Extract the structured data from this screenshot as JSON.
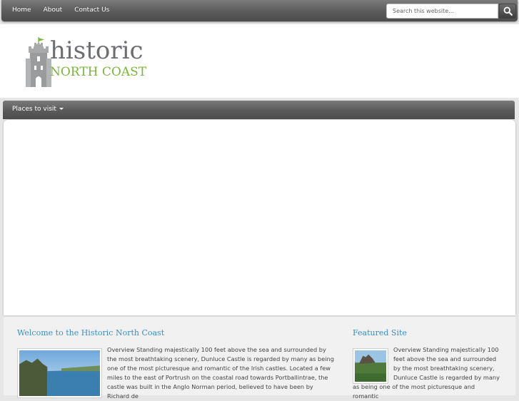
{
  "topnav": {
    "items": [
      "Home",
      "About",
      "Contact Us"
    ]
  },
  "search": {
    "placeholder": "Search this website…"
  },
  "logo": {
    "line1": "historic",
    "line2": "NORTH COAST"
  },
  "menu": {
    "places_label": "Places to visit"
  },
  "welcome": {
    "title": "Welcome to the Historic North Coast",
    "text": "Overview Standing majestically 100 feet above the sea and surrounded by the most breathtaking scenery, Dunluce Castle is regarded by many as being one of the most picturesque and romantic of the Irish castles. Located a few miles to the east of Portrush on the coastal road towards Portballintrae, the castle was built in the Anglo Norman period, believed to have been by Richard de"
  },
  "featured": {
    "title": "Featured Site",
    "text_indented": "Overview Standing majestically 100 feet above the sea and surrounded by the most breathtaking scenery, Dunluce Castle is regarded by many",
    "text_full": "as being one of the most picturesque and romantic"
  },
  "colors": {
    "accent_blue": "#3b8fc4",
    "logo_green": "#7ab53d",
    "logo_grey": "#6d6e70"
  }
}
